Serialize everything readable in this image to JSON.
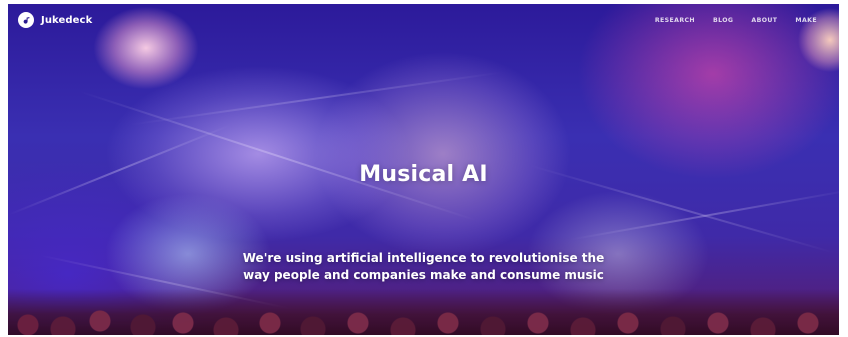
{
  "brand": {
    "name": "Jukedeck",
    "logo_icon": "jukedeck-logo-icon"
  },
  "nav": {
    "items": [
      {
        "label": "RESEARCH"
      },
      {
        "label": "BLOG"
      },
      {
        "label": "ABOUT"
      },
      {
        "label": "MAKE"
      }
    ]
  },
  "hero": {
    "title": "Musical AI",
    "tagline_lines": [
      "We're using artificial intelligence to revolutionise the",
      "way people and companies make and consume music"
    ],
    "background_icon": "concert-lights-image"
  },
  "colors": {
    "hero_base": "#2a1a8f",
    "text": "#ffffff"
  }
}
